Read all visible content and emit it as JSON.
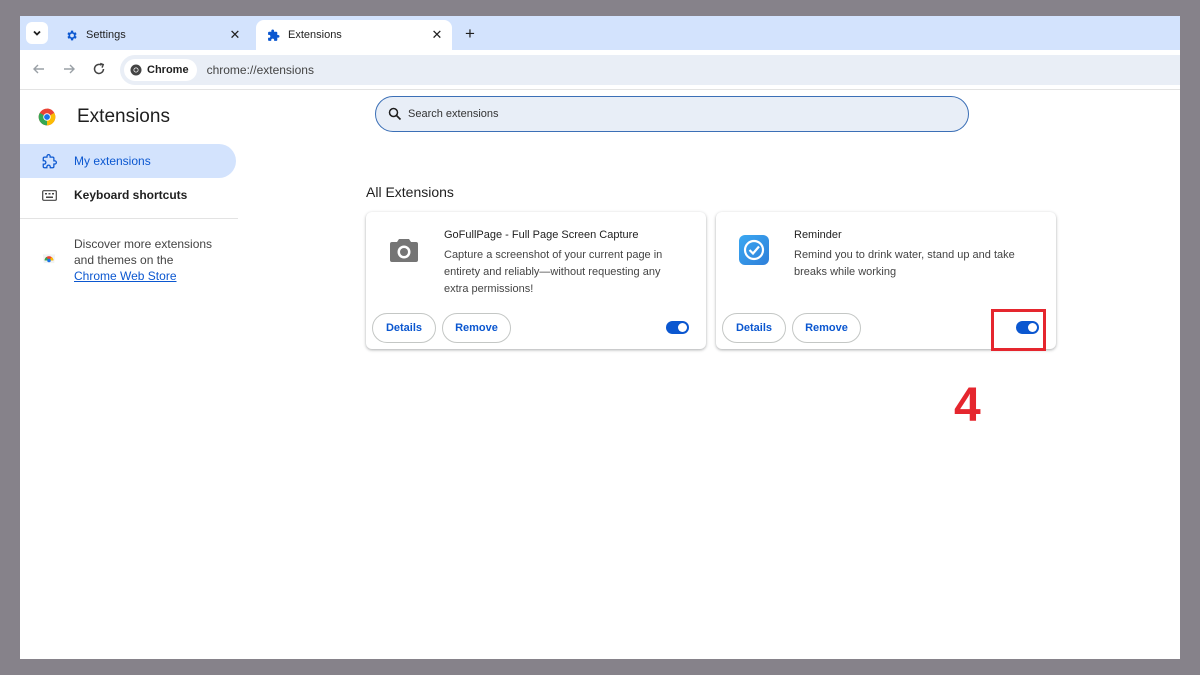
{
  "tabs": [
    {
      "title": "Settings",
      "icon": "gear-icon"
    },
    {
      "title": "Extensions",
      "icon": "puzzle-icon"
    }
  ],
  "toolbar": {
    "chip_label": "Chrome",
    "url": "chrome://extensions"
  },
  "sidebar": {
    "title": "Extensions",
    "items": [
      {
        "label": "My extensions",
        "icon": "extensions-icon"
      },
      {
        "label": "Keyboard shortcuts",
        "icon": "keyboard-icon"
      }
    ],
    "discover_text": "Discover more extensions and themes on the",
    "discover_link": "Chrome Web Store"
  },
  "search": {
    "placeholder": "Search extensions"
  },
  "section_title": "All Extensions",
  "extensions": [
    {
      "name": "GoFullPage - Full Page Screen Capture",
      "description": "Capture a screenshot of your current page in entirety and reliably—without requesting any extra permissions!",
      "details_label": "Details",
      "remove_label": "Remove",
      "enabled": true,
      "icon": "camera-icon"
    },
    {
      "name": "Reminder",
      "description": "Remind you to drink water, stand up and take breaks while working",
      "details_label": "Details",
      "remove_label": "Remove",
      "enabled": true,
      "icon": "checkmark-icon"
    }
  ],
  "annotation": {
    "step_number": "4",
    "color": "#e5262e"
  },
  "colors": {
    "accent": "#0b57d0",
    "tabstrip": "#d3e3fd"
  }
}
